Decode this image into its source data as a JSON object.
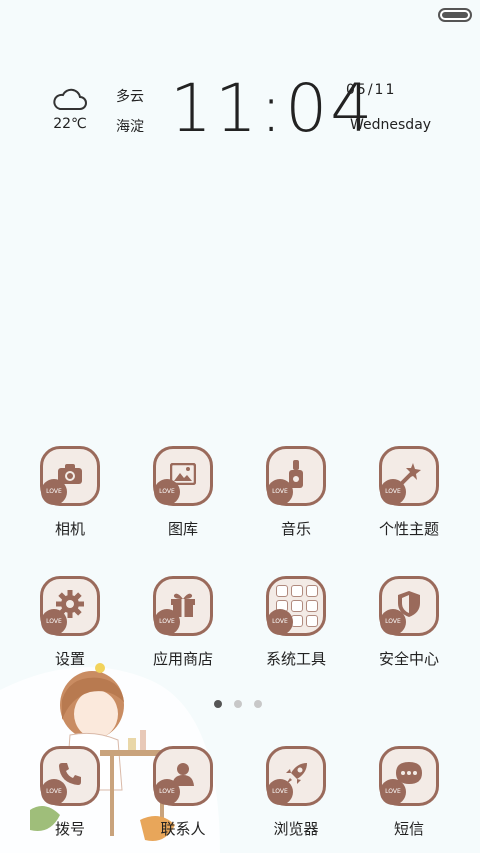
{
  "status": {
    "battery_icon": "battery-icon"
  },
  "weather": {
    "icon": "cloud-icon",
    "temperature": "22℃",
    "condition": "多云",
    "location": "海淀"
  },
  "clock": {
    "hour": "11",
    "colon": ":",
    "minute": "04"
  },
  "date": {
    "date": "05/11",
    "weekday": "Wednesday"
  },
  "apps": [
    {
      "label": "相机",
      "icon": "camera-icon"
    },
    {
      "label": "图库",
      "icon": "gallery-icon"
    },
    {
      "label": "音乐",
      "icon": "music-icon"
    },
    {
      "label": "个性主题",
      "icon": "magic-wand-icon"
    },
    {
      "label": "设置",
      "icon": "gear-icon"
    },
    {
      "label": "应用商店",
      "icon": "gift-icon"
    },
    {
      "label": "系统工具",
      "icon": "tools-folder-icon"
    },
    {
      "label": "安全中心",
      "icon": "shield-icon"
    }
  ],
  "dock": [
    {
      "label": "拨号",
      "icon": "phone-icon"
    },
    {
      "label": "联系人",
      "icon": "contact-icon"
    },
    {
      "label": "浏览器",
      "icon": "rocket-icon"
    },
    {
      "label": "短信",
      "icon": "message-icon"
    }
  ],
  "love_badge": "LOVE",
  "pager": {
    "pages": 3,
    "current": 1
  },
  "colors": {
    "accent": "#9a6a5b",
    "icon_bg": "#f3ebe6",
    "background": "#f5fbfc"
  }
}
